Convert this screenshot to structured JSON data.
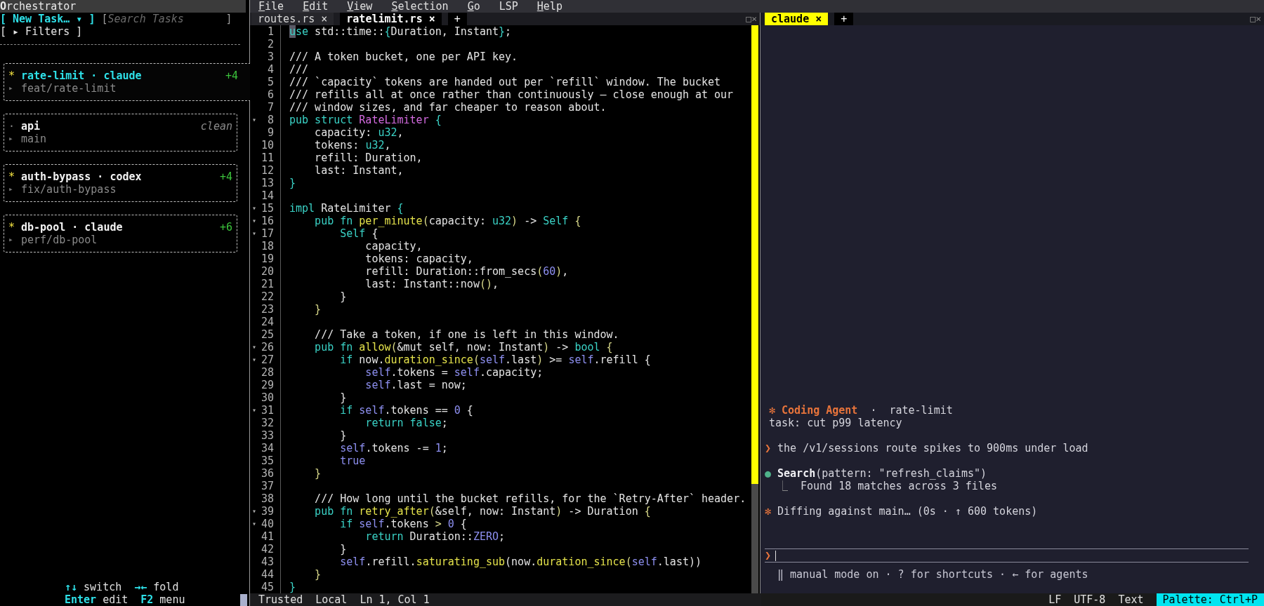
{
  "sidebar": {
    "title": "**O**rchestrator",
    "new_task": "[ New Task… ▾ ]",
    "search": {
      "open": "[",
      "placeholder": "Search Tasks",
      "close": "]"
    },
    "filters": "[ ▸ Filters ]",
    "tasks": [
      {
        "marker": "*",
        "title": "rate-limit · claude",
        "diff": "+4",
        "branch_marker": "▸",
        "branch": "feat/rate-limit",
        "selected": true
      },
      {
        "marker": "·",
        "title": "api",
        "status": "clean",
        "branch_marker": "▸",
        "branch": "main",
        "selected": false
      },
      {
        "marker": "*",
        "title": "auth-bypass · codex",
        "diff": "+4",
        "branch_marker": "▸",
        "branch": "fix/auth-bypass",
        "selected": false
      },
      {
        "marker": "*",
        "title": "db-pool · claude",
        "diff": "+6",
        "branch_marker": "▸",
        "branch": "perf/db-pool",
        "selected": false
      }
    ],
    "hints": [
      [
        {
          "key": "↑↓",
          "label": "switch"
        },
        {
          "key": "→←",
          "label": "fold"
        }
      ],
      [
        {
          "key": "Enter",
          "label": "edit"
        },
        {
          "key": "F2",
          "label": "menu"
        }
      ]
    ]
  },
  "menu": [
    {
      "label": "File",
      "accel": true
    },
    {
      "label": "Edit",
      "accel": true
    },
    {
      "label": "View",
      "accel": true
    },
    {
      "label": "Selection",
      "accel": true
    },
    {
      "label": "Go",
      "accel": true
    },
    {
      "label": "LSP",
      "accel": false
    },
    {
      "label": "Help",
      "accel": true
    }
  ],
  "editor": {
    "tabs": [
      {
        "label": "routes.rs",
        "close": "×",
        "selected": false
      },
      {
        "label": "ratelimit.rs",
        "close": "×",
        "selected": true
      }
    ],
    "new_tab": "+",
    "pane_controls": [
      "□",
      "×"
    ],
    "lines": [
      {
        "number": "1",
        "segments": [
          {
            "kind": "cursor",
            "text": "u"
          },
          {
            "kind": "keyword",
            "text": "se"
          },
          " std::time::",
          {
            "kind": "keyword",
            "text": "{"
          },
          "Duration, Instant",
          {
            "kind": "keyword",
            "text": "}"
          },
          ";"
        ]
      },
      {
        "number": "2"
      },
      {
        "number": "3",
        "segments": [
          "/// A token bucket, one per API key."
        ]
      },
      {
        "number": "4",
        "segments": [
          "///"
        ]
      },
      {
        "number": "5",
        "segments": [
          "/// `capacity` tokens are handed out per `refill` window. The bucket"
        ]
      },
      {
        "number": "6",
        "segments": [
          "/// refills all at once rather than continuously — close enough at our"
        ]
      },
      {
        "number": "7",
        "segments": [
          "/// window sizes, and far cheaper to reason about."
        ]
      },
      {
        "number": "8",
        "fold": "▾",
        "segments": [
          {
            "kind": "keyword",
            "text": "pub struct"
          },
          {
            "kind": "type",
            "text": " RateLimiter"
          },
          {
            "kind": "keyword",
            "text": " {"
          }
        ]
      },
      {
        "number": "9",
        "segments": [
          "    capacity: ",
          {
            "kind": "keyword",
            "text": "u32"
          },
          ","
        ]
      },
      {
        "number": "10",
        "segments": [
          "    tokens: ",
          {
            "kind": "keyword",
            "text": "u32"
          },
          ","
        ]
      },
      {
        "number": "11",
        "segments": [
          "    refill: Duration,"
        ]
      },
      {
        "number": "12",
        "segments": [
          "    last: Instant,"
        ]
      },
      {
        "number": "13",
        "segments": [
          {
            "kind": "keyword",
            "text": "}"
          }
        ]
      },
      {
        "number": "14"
      },
      {
        "number": "15",
        "fold": "▾",
        "segments": [
          {
            "kind": "keyword",
            "text": "impl"
          },
          " RateLimiter ",
          {
            "kind": "keyword",
            "text": "{"
          }
        ]
      },
      {
        "number": "16",
        "fold": "▾",
        "segments": [
          {
            "kind": "keyword",
            "text": "    pub fn"
          },
          {
            "kind": "function",
            "text": " per_minute"
          },
          {
            "kind": "bracket",
            "text": "("
          },
          "capacity: ",
          {
            "kind": "keyword",
            "text": "u32"
          },
          {
            "kind": "bracket",
            "text": ")"
          },
          " -> ",
          {
            "kind": "keyword",
            "text": "Self"
          },
          {
            "kind": "bracket",
            "text": " {"
          }
        ]
      },
      {
        "number": "17",
        "fold": "▾",
        "segments": [
          {
            "kind": "keyword",
            "text": "        Self"
          },
          " {"
        ]
      },
      {
        "number": "18",
        "segments": [
          "            capacity,"
        ]
      },
      {
        "number": "19",
        "segments": [
          "            tokens: capacity,"
        ]
      },
      {
        "number": "20",
        "segments": [
          "            refill: Duration::from_secs",
          {
            "kind": "bracket",
            "text": "("
          },
          {
            "kind": "literal",
            "text": "60"
          },
          {
            "kind": "bracket",
            "text": ")"
          },
          ","
        ]
      },
      {
        "number": "21",
        "segments": [
          "            last: Instant::now",
          {
            "kind": "bracket",
            "text": "()"
          },
          ","
        ]
      },
      {
        "number": "22",
        "segments": [
          "        }"
        ]
      },
      {
        "number": "23",
        "segments": [
          {
            "kind": "bracket",
            "text": "    }"
          }
        ]
      },
      {
        "number": "24"
      },
      {
        "number": "25",
        "segments": [
          "    /// Take a token, if one is left in this window."
        ]
      },
      {
        "number": "26",
        "fold": "▾",
        "segments": [
          {
            "kind": "keyword",
            "text": "    pub fn"
          },
          {
            "kind": "function",
            "text": " allow"
          },
          {
            "kind": "bracket",
            "text": "("
          },
          "&mut self, now: Instant",
          {
            "kind": "bracket",
            "text": ")"
          },
          " -> ",
          {
            "kind": "keyword",
            "text": "bool"
          },
          {
            "kind": "bracket",
            "text": " {"
          }
        ]
      },
      {
        "number": "27",
        "fold": "▾",
        "segments": [
          {
            "kind": "keyword",
            "text": "        if"
          },
          " now.",
          {
            "kind": "function",
            "text": "duration_since"
          },
          {
            "kind": "bracket",
            "text": "("
          },
          {
            "kind": "literal",
            "text": "self"
          },
          ".last",
          {
            "kind": "bracket",
            "text": ")"
          },
          " >= ",
          {
            "kind": "literal",
            "text": "self"
          },
          ".refill {"
        ]
      },
      {
        "number": "28",
        "segments": [
          {
            "kind": "literal",
            "text": "            self"
          },
          ".tokens = ",
          {
            "kind": "literal",
            "text": "self"
          },
          ".capacity;"
        ]
      },
      {
        "number": "29",
        "segments": [
          {
            "kind": "literal",
            "text": "            self"
          },
          ".last = now;"
        ]
      },
      {
        "number": "30",
        "segments": [
          "        }"
        ]
      },
      {
        "number": "31",
        "fold": "▾",
        "segments": [
          {
            "kind": "keyword",
            "text": "        if"
          },
          {
            "kind": "literal",
            "text": " self"
          },
          ".tokens == ",
          {
            "kind": "literal",
            "text": "0"
          },
          " {"
        ]
      },
      {
        "number": "32",
        "segments": [
          {
            "kind": "keyword",
            "text": "            return false"
          },
          ";"
        ]
      },
      {
        "number": "33",
        "segments": [
          "        }"
        ]
      },
      {
        "number": "34",
        "segments": [
          {
            "kind": "literal",
            "text": "        self"
          },
          ".tokens -= ",
          {
            "kind": "literal",
            "text": "1"
          },
          ";"
        ]
      },
      {
        "number": "35",
        "segments": [
          {
            "kind": "literal",
            "text": "        true"
          }
        ]
      },
      {
        "number": "36",
        "segments": [
          {
            "kind": "bracket",
            "text": "    }"
          }
        ]
      },
      {
        "number": "37"
      },
      {
        "number": "38",
        "segments": [
          "    /// How long until the bucket refills, for the `Retry-After` header."
        ]
      },
      {
        "number": "39",
        "fold": "▾",
        "segments": [
          {
            "kind": "keyword",
            "text": "    pub fn"
          },
          {
            "kind": "function",
            "text": " retry_after"
          },
          {
            "kind": "bracket",
            "text": "("
          },
          "&self, now: Instant",
          {
            "kind": "bracket",
            "text": ")"
          },
          " -> Duration",
          {
            "kind": "bracket",
            "text": " {"
          }
        ]
      },
      {
        "number": "40",
        "fold": "▾",
        "segments": [
          {
            "kind": "keyword",
            "text": "        if"
          },
          {
            "kind": "literal",
            "text": " self"
          },
          ".tokens ",
          {
            "kind": "bracket",
            "text": ">"
          },
          {
            "kind": "literal",
            "text": " 0"
          },
          " {"
        ]
      },
      {
        "number": "41",
        "segments": [
          {
            "kind": "keyword",
            "text": "            return"
          },
          " Duration::",
          {
            "kind": "literal",
            "text": "ZERO"
          },
          ";"
        ]
      },
      {
        "number": "42",
        "segments": [
          "        }"
        ]
      },
      {
        "number": "43",
        "segments": [
          {
            "kind": "literal",
            "text": "        self"
          },
          ".refill.",
          {
            "kind": "function",
            "text": "saturating_sub"
          },
          "(now.",
          {
            "kind": "function",
            "text": "duration_since"
          },
          {
            "kind": "bracket",
            "text": "("
          },
          {
            "kind": "literal",
            "text": "self"
          },
          ".last))"
        ]
      },
      {
        "number": "44",
        "segments": [
          {
            "kind": "bracket",
            "text": "    }"
          }
        ]
      },
      {
        "number": "45",
        "segments": [
          {
            "kind": "keyword",
            "text": "}"
          }
        ]
      }
    ],
    "status": [
      "Trusted",
      "Local",
      "Ln 1, Col 1"
    ]
  },
  "agent": {
    "tabs": [
      {
        "label": "claude",
        "close": "×",
        "selected": true
      }
    ],
    "new_tab": "+",
    "pane_controls": [
      "□",
      "×"
    ],
    "header": {
      "icon": "✻",
      "name": "Coding Agent",
      "separator": "·",
      "task_name": "rate-limit"
    },
    "task": "task: cut p99 latency",
    "prompt": {
      "marker": "❯",
      "text": "the /v1/sessions route spikes to 900ms under load"
    },
    "tool": {
      "marker": "●",
      "name": "Search",
      "args": "(pattern: \"refresh_claims\")",
      "result_marker": "⎿",
      "result": "Found 18 matches across 3 files"
    },
    "progress": {
      "icon": "✻",
      "text": "Diffing against main… (0s · ↑ 600 tokens)"
    },
    "input": {
      "marker": "❯"
    },
    "footer": "‖ manual mode on · ? for shortcuts · ← for agents"
  },
  "status_bar": {
    "items": [
      "LF",
      "UTF-8",
      "Text"
    ],
    "palette": "Palette: Ctrl+P"
  }
}
